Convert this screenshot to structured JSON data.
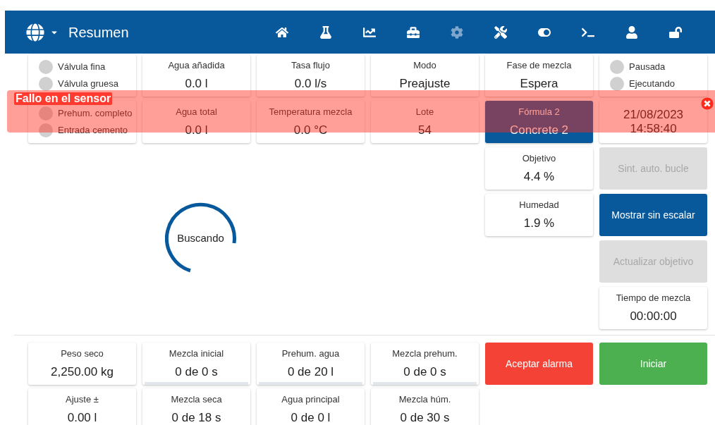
{
  "top_bar": {
    "title": "Resumen",
    "nav": [
      {
        "disabled": false
      },
      {
        "disabled": false
      },
      {
        "disabled": false
      },
      {
        "disabled": false
      },
      {
        "disabled": true
      },
      {
        "disabled": false
      },
      {
        "disabled": false
      },
      {
        "disabled": false
      },
      {
        "disabled": false
      },
      {
        "disabled": false
      }
    ]
  },
  "alert": {
    "message": "Fallo en el sensor"
  },
  "top_cards": [
    {
      "kind": "lamps",
      "lamps": [
        {
          "label": "Válvula fina",
          "on": false
        },
        {
          "label": "Válvula gruesa",
          "on": false
        }
      ]
    },
    {
      "kind": "value",
      "label": "Agua añadida",
      "value": "0.0 l"
    },
    {
      "kind": "value",
      "label": "Tasa flujo",
      "value": "0.0 l/s"
    },
    {
      "kind": "value",
      "label": "Modo",
      "value": "Preajuste"
    },
    {
      "kind": "value",
      "label": "Fase de mezcla",
      "value": "Espera"
    },
    {
      "kind": "lamps",
      "lamps": [
        {
          "label": "Pausada",
          "on": false
        },
        {
          "label": "Ejecutando",
          "on": false
        }
      ]
    },
    {
      "kind": "lamps",
      "lamps": [
        {
          "label": "Prehum. completo",
          "on": false
        },
        {
          "label": "Entrada cemento",
          "on": false
        }
      ]
    },
    {
      "kind": "value",
      "label": "Agua total",
      "value": "0.0 l"
    },
    {
      "kind": "value",
      "label": "Temperatura mezcla",
      "value": "0.0 °C"
    },
    {
      "kind": "value",
      "label": "Lote",
      "value": "54"
    },
    {
      "kind": "highlight",
      "label": "Fórmula 2",
      "value": "Concrete 2"
    },
    {
      "kind": "datetime",
      "date": "21/08/2023",
      "time": "14:58:40"
    }
  ],
  "side_cards": [
    {
      "label": "Objetivo",
      "value": "4.4 %"
    },
    {
      "label": "Humedad",
      "value": "1.9 %"
    }
  ],
  "side_buttons": [
    {
      "label": "Sint. auto. bucle",
      "disabled": true
    },
    {
      "label": "Mostrar sin escalar",
      "disabled": false
    },
    {
      "label": "Actualizar objetivo",
      "disabled": true
    }
  ],
  "mix_time": {
    "label": "Tiempo de mezcla",
    "value": "00:00:00"
  },
  "spinner": {
    "label": "Buscando"
  },
  "bottom_cards": [
    {
      "label": "Peso seco",
      "value": "2,250.00 kg"
    },
    {
      "label": "Mezcla inicial",
      "value": "0 de 0 s",
      "level": 0
    },
    {
      "label": "Prehum. agua",
      "value": "0 de 20 l",
      "level": 0
    },
    {
      "label": "Mezcla prehum.",
      "value": "0 de 0 s",
      "level": 0
    },
    {
      "label": "Ajuste ±",
      "value": "0.00 l"
    },
    {
      "label": "Mezcla seca",
      "value": "0 de 18 s"
    },
    {
      "label": "Agua principal",
      "value": "0 de 0 l"
    },
    {
      "label": "Mezcla húm.",
      "value": "0 de 30 s"
    }
  ],
  "actions": [
    {
      "kind": "danger",
      "label": "Aceptar alarma"
    },
    {
      "kind": "success",
      "label": "Iniciar"
    }
  ]
}
